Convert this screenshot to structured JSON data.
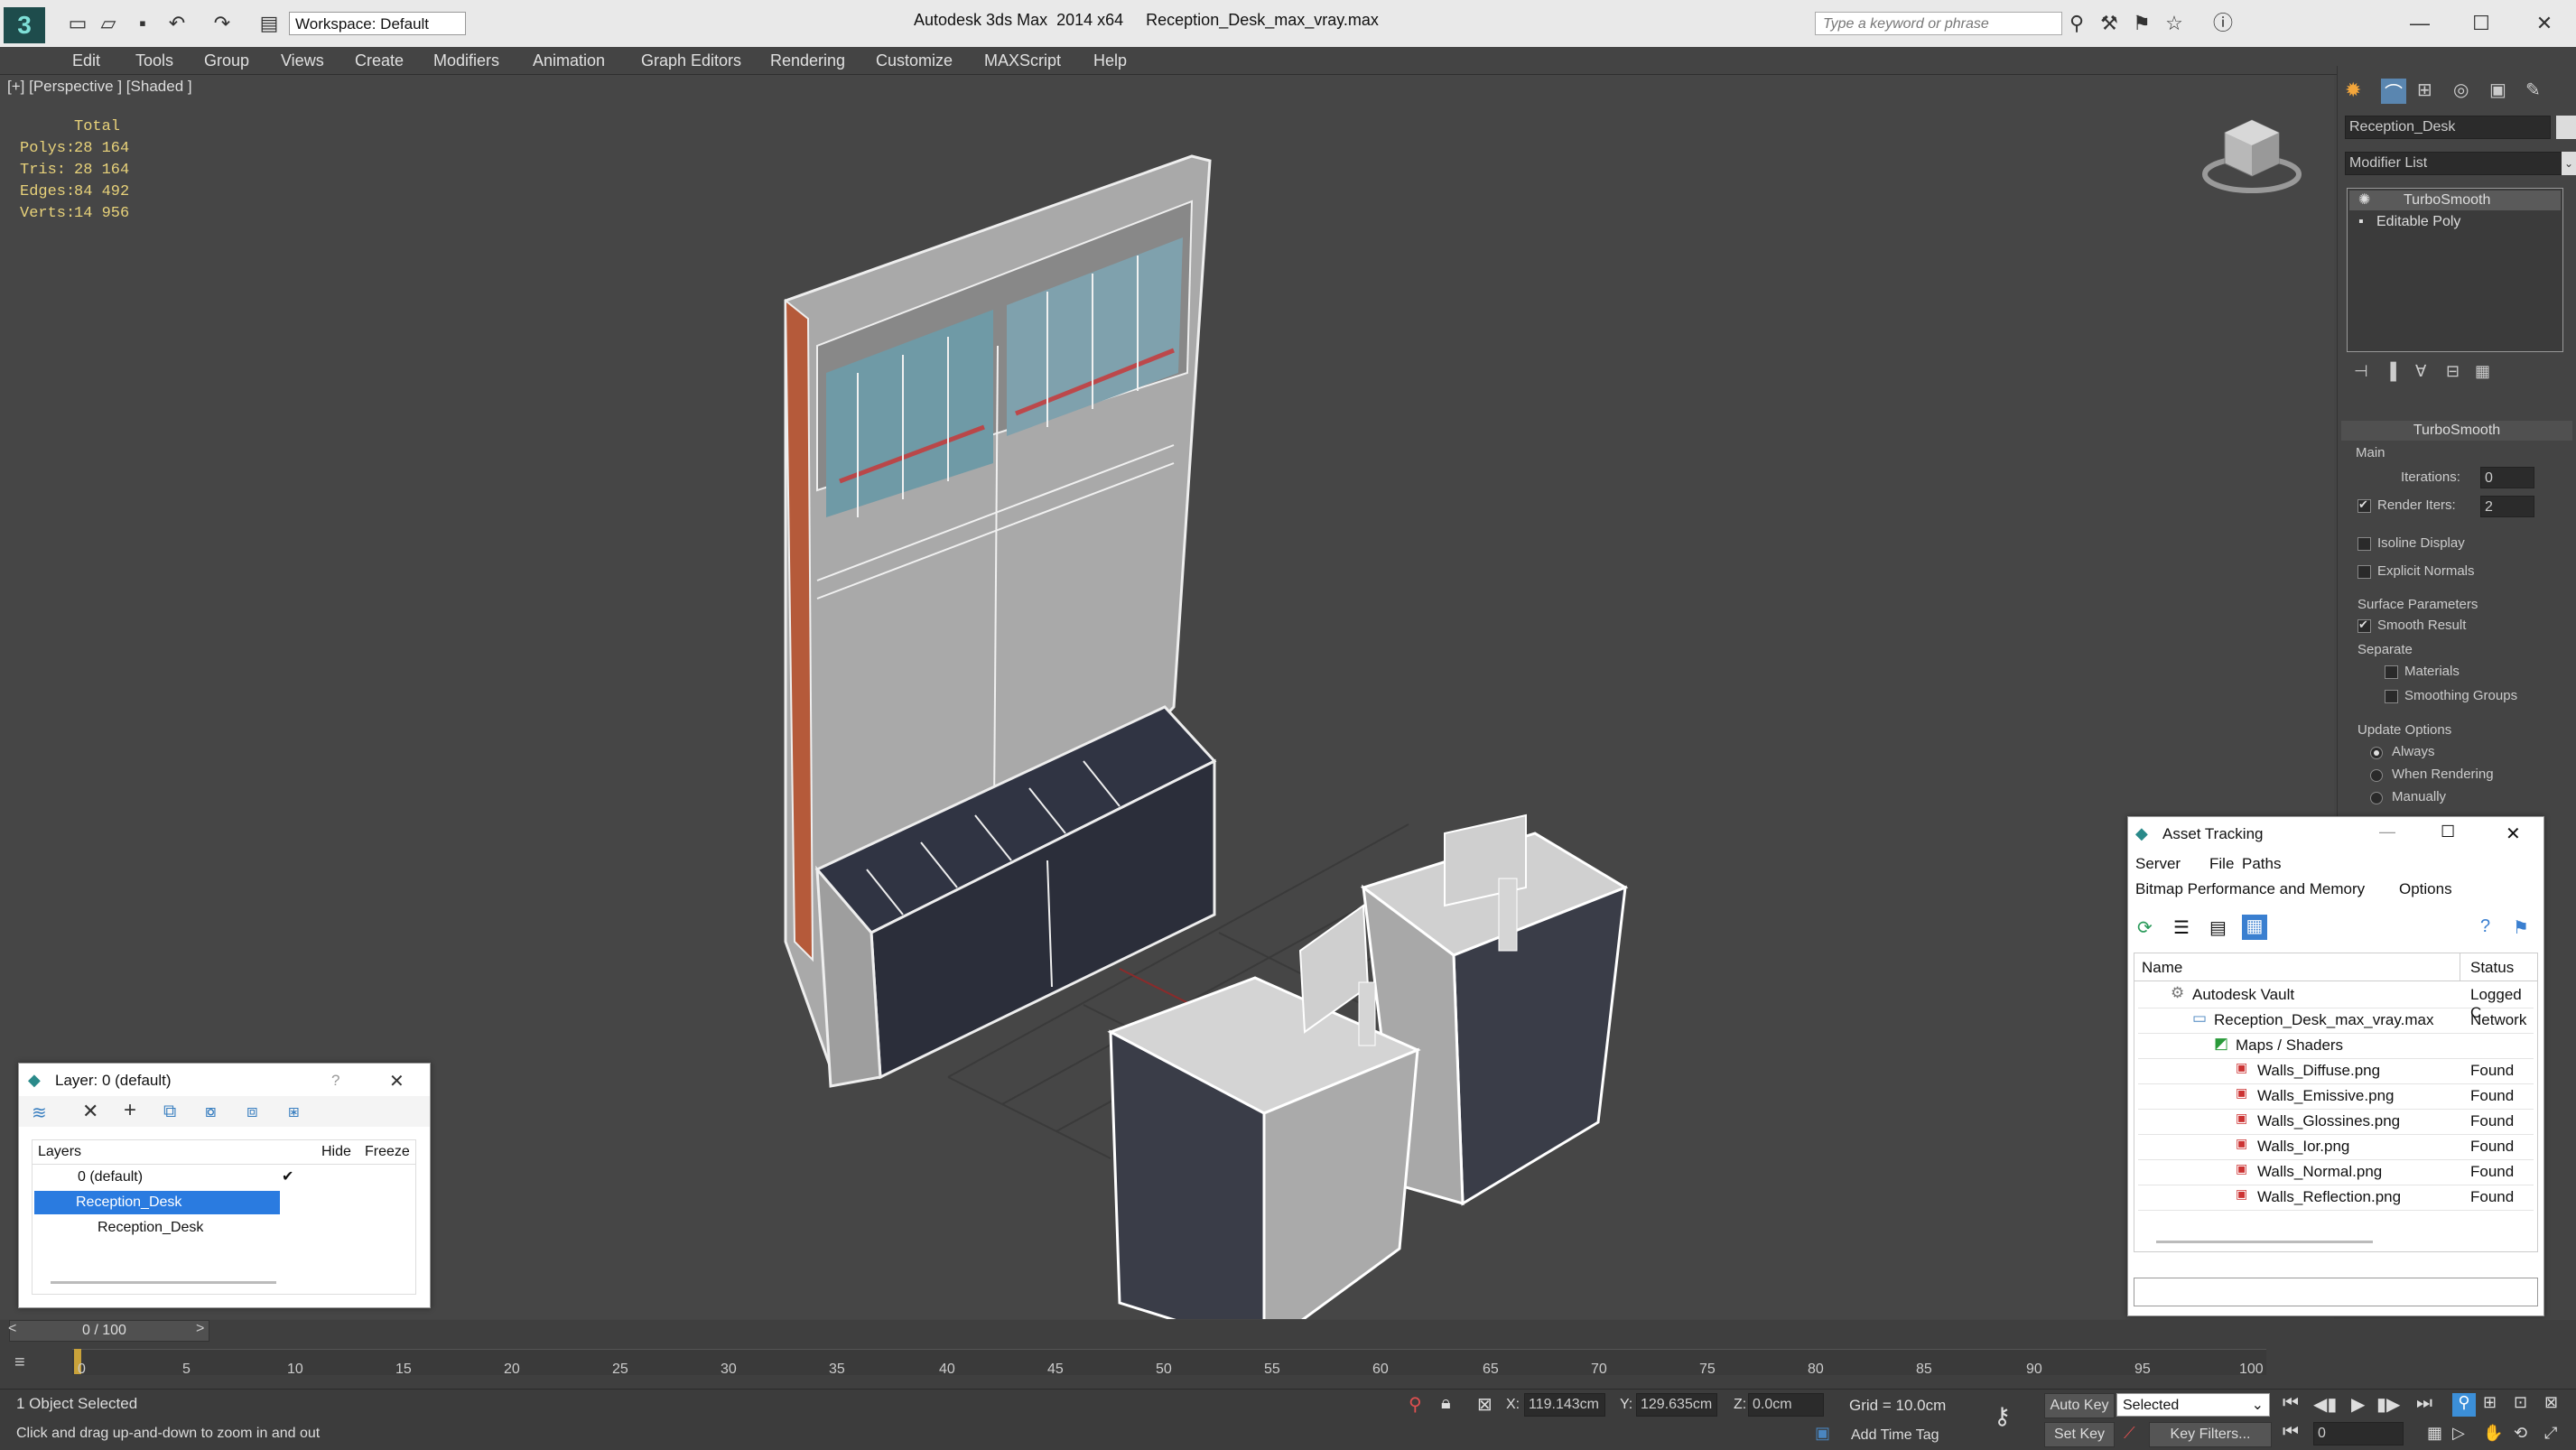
{
  "titlebar": {
    "workspace": "Workspace: Default",
    "title": "Autodesk 3ds Max  2014 x64     Reception_Desk_max_vray.max",
    "search_placeholder": "Type a keyword or phrase"
  },
  "menu": [
    "Edit",
    "Tools",
    "Group",
    "Views",
    "Create",
    "Modifiers",
    "Animation",
    "Graph Editors",
    "Rendering",
    "Customize",
    "MAXScript",
    "Help"
  ],
  "viewport": {
    "label": "[+] [Perspective ] [Shaded ]",
    "stats_header": "Total",
    "stats": [
      {
        "label": "Polys:",
        "value": "28 164"
      },
      {
        "label": "Tris:",
        "value": "28 164"
      },
      {
        "label": "Edges:",
        "value": "84 492"
      },
      {
        "label": "Verts:",
        "value": "14 956"
      }
    ]
  },
  "command_panel": {
    "object_name": "Reception_Desk",
    "modifier_list": "Modifier List",
    "stack": [
      "TurboSmooth",
      "Editable Poly"
    ],
    "rollout_title": "TurboSmooth",
    "main": "Main",
    "iterations_label": "Iterations:",
    "iterations_value": "0",
    "render_iters_label": "Render Iters:",
    "render_iters_value": "2",
    "isoline": "Isoline Display",
    "explicit": "Explicit Normals",
    "surface_params": "Surface Parameters",
    "smooth_result": "Smooth Result",
    "separate": "Separate",
    "materials": "Materials",
    "smoothing_groups": "Smoothing Groups",
    "update_options": "Update Options",
    "always": "Always",
    "when_rendering": "When Rendering",
    "manually": "Manually"
  },
  "layer_window": {
    "title": "Layer: 0 (default)",
    "help": "?",
    "col_layers": "Layers",
    "col_hide": "Hide",
    "col_freeze": "Freeze",
    "rows": [
      "0 (default)",
      "Reception_Desk",
      "Reception_Desk"
    ]
  },
  "asset_window": {
    "title": "Asset Tracking",
    "menu": [
      "Server",
      "File",
      "Paths"
    ],
    "menu2": [
      "Bitmap Performance and Memory",
      "Options"
    ],
    "col_name": "Name",
    "col_status": "Status",
    "rows": [
      {
        "name": "Autodesk Vault",
        "status": "Logged C"
      },
      {
        "name": "Reception_Desk_max_vray.max",
        "status": "Network"
      },
      {
        "name": "Maps / Shaders",
        "status": ""
      },
      {
        "name": "Walls_Diffuse.png",
        "status": "Found"
      },
      {
        "name": "Walls_Emissive.png",
        "status": "Found"
      },
      {
        "name": "Walls_Glossines.png",
        "status": "Found"
      },
      {
        "name": "Walls_Ior.png",
        "status": "Found"
      },
      {
        "name": "Walls_Normal.png",
        "status": "Found"
      },
      {
        "name": "Walls_Reflection.png",
        "status": "Found"
      }
    ]
  },
  "timeline": {
    "frame": "0 / 100",
    "ticks": [
      "0",
      "5",
      "10",
      "15",
      "20",
      "25",
      "30",
      "35",
      "40",
      "45",
      "50",
      "55",
      "60",
      "65",
      "70",
      "75",
      "80",
      "85",
      "90",
      "95",
      "100"
    ]
  },
  "status": {
    "selected": "1 Object Selected",
    "prompt": "Click and drag up-and-down to zoom in and out",
    "x_label": "X:",
    "x_value": "119.143cm",
    "y_label": "Y:",
    "y_value": "129.635cm",
    "z_label": "Z:",
    "z_value": "0.0cm",
    "grid": "Grid = 10.0cm",
    "add_time_tag": "Add Time Tag",
    "auto_key": "Auto Key",
    "set_key": "Set Key",
    "selected_dropdown": "Selected",
    "key_filters": "Key Filters...",
    "frame_field": "0"
  },
  "colors": {
    "viewport_bg": "#464646",
    "panel_bg": "#444444",
    "accent": "#3c8fd8",
    "stat_yellow": "#e8d27a"
  }
}
